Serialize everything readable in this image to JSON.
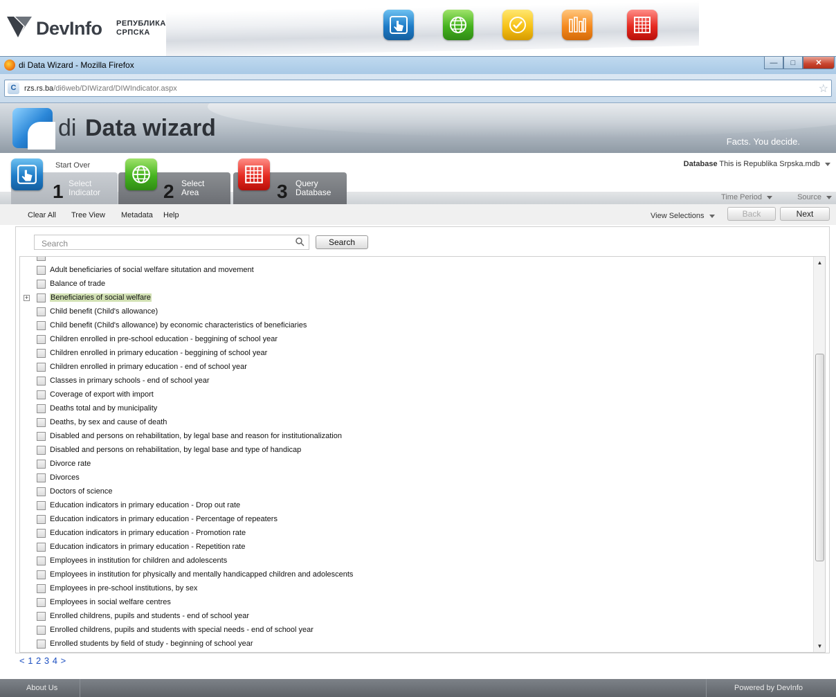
{
  "banner": {
    "brand": "DevInfo",
    "subtitle_line1": "РЕПУБЛИКА",
    "subtitle_line2": "СРПСКА",
    "tiles": [
      "select-indicator-icon",
      "select-area-icon",
      "check-icon",
      "bar-chart-icon",
      "table-grid-icon"
    ]
  },
  "browser": {
    "window_title": "di Data Wizard - Mozilla Firefox",
    "url_host": "rzs.rs.ba",
    "url_path": "/di6web/DIWizard/DIWIndicator.aspx",
    "window_controls": [
      "minimize",
      "maximize",
      "close"
    ]
  },
  "app": {
    "title_prefix": "di",
    "title_main": "Data wizard",
    "tagline": "Facts. You decide."
  },
  "wizard": {
    "start_over": "Start Over",
    "steps": [
      {
        "number": "1",
        "line1": "Select",
        "line2": "Indicator"
      },
      {
        "number": "2",
        "line1": "Select",
        "line2": "Area"
      },
      {
        "number": "3",
        "line1": "Query",
        "line2": "Database"
      }
    ],
    "database_label": "Database",
    "database_value": "This is Republika Srpska.mdb",
    "time_period": "Time Period",
    "source": "Source"
  },
  "toolbar": {
    "clear_all": "Clear All",
    "tree_view": "Tree View",
    "metadata": "Metadata",
    "help": "Help",
    "view_selections": "View Selections",
    "back": "Back",
    "next": "Next"
  },
  "search": {
    "placeholder": "Search",
    "button": "Search"
  },
  "indicators": [
    "Adult beneficiaries of social welfare situtation and movement",
    "Balance of trade",
    "Beneficiaries of social welfare",
    "Child benefit (Child's allowance)",
    "Child benefit (Child's allowance) by economic characteristics of beneficiaries",
    "Children enrolled in pre-school education - beggining of school year",
    "Children enrolled in primary education - beggining of school year",
    "Children enrolled in primary education - end of school year",
    "Classes in primary schools - end of school year",
    "Coverage of export with import",
    "Deaths total and by municipality",
    "Deaths, by sex and cause of death",
    "Disabled and persons on rehabilitation, by legal base and reason for institutionalization",
    "Disabled and persons on rehabilitation, by legal base and type of handicap",
    "Divorce rate",
    "Divorces",
    "Doctors of science",
    "Education indicators in primary education - Drop out rate",
    "Education indicators in primary education - Percentage of repeaters",
    "Education indicators in primary education - Promotion rate",
    "Education indicators in primary education - Repetition rate",
    "Employees in institution for children and adolescents",
    "Employees in institution for physically and mentally handicapped children and adolescents",
    "Employees in pre-school institutions, by sex",
    "Employees in social welfare centres",
    "Enrolled childrens, pupils and students - end of school year",
    "Enrolled childrens, pupils and students with special needs - end of school year",
    "Enrolled students by field of study - beginning of school year"
  ],
  "highlighted_indicator": "Beneficiaries of social welfare",
  "pager": "< 1 2 3 4 >",
  "footer": {
    "about": "About Us",
    "powered": "Powered by DevInfo"
  }
}
